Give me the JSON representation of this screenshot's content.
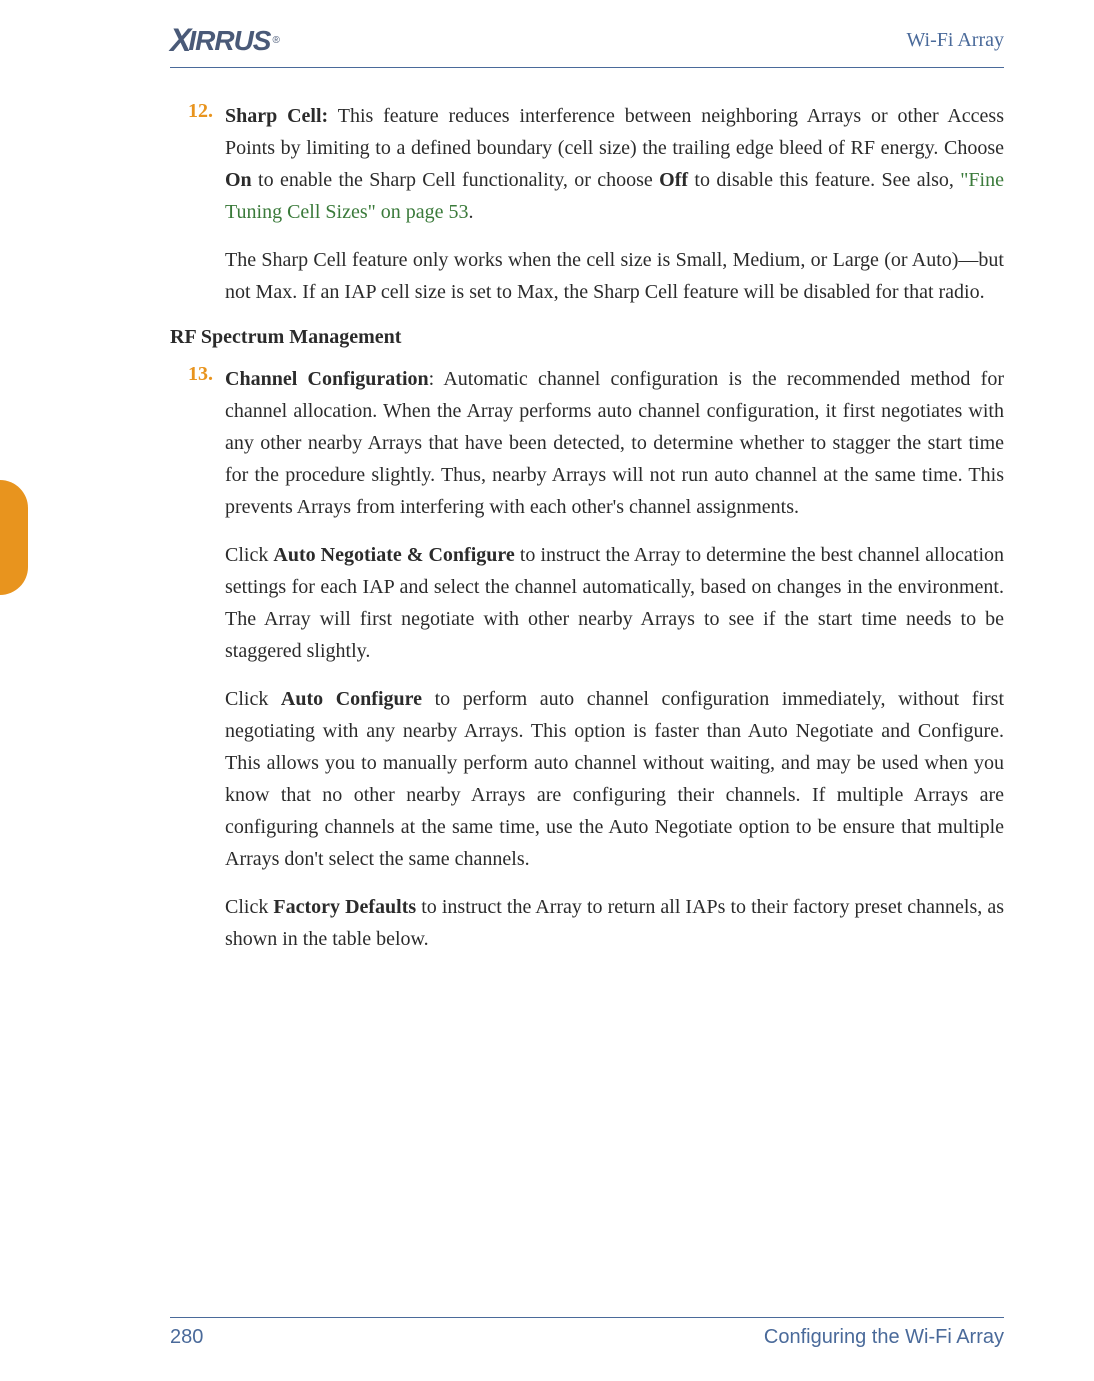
{
  "header": {
    "logo_text": "XIRRUS",
    "right_text": "Wi-Fi Array"
  },
  "items": [
    {
      "number": "12.",
      "title": "Sharp Cell:",
      "para1_a": " This feature reduces interference between neighboring Arrays or other Access Points by limiting to a defined boundary (cell size) the trailing edge bleed of RF energy. Choose ",
      "bold1": "On",
      "para1_b": " to enable the Sharp Cell functionality, or choose ",
      "bold2": "Off",
      "para1_c": " to disable this feature. See also, ",
      "link1": "\"Fine Tuning Cell Sizes\" on page 53",
      "para1_d": ".",
      "para2": "The Sharp Cell feature only works when the cell size is Small, Medium, or Large (or Auto)—but not Max. If an IAP cell size is set to Max, the Sharp Cell feature will be disabled for that radio."
    }
  ],
  "section_heading": "RF Spectrum Management",
  "items2": [
    {
      "number": "13.",
      "title": "Channel Configuration",
      "para1": ": Automatic channel configuration is the recommended method for channel allocation. When the Array performs auto channel configuration, it first negotiates with any other nearby Arrays that have been detected, to determine whether to stagger the start time for the procedure slightly. Thus, nearby Arrays will not run auto channel at the same time. This prevents Arrays from interfering with each other's channel assignments.",
      "para2_a": "Click ",
      "bold1": "Auto Negotiate & Configure",
      "para2_b": " to instruct the Array to determine the best channel allocation settings for each IAP and select the channel automatically, based on changes in the environment. The Array will first negotiate with other nearby Arrays to see if the start time needs to be staggered slightly.",
      "para3_a": "Click ",
      "bold2": "Auto Configure",
      "para3_b": " to perform auto channel configuration immediately, without first negotiating with any nearby Arrays. This option is faster than Auto Negotiate and Configure. This allows you to manually perform auto channel without waiting, and may be used when you know that no other nearby Arrays are configuring their channels. If multiple Arrays are configuring channels at the same time, use the Auto Negotiate option to be ensure that multiple Arrays don't select the same channels.",
      "para4_a": "Click ",
      "bold3": "Factory Defaults",
      "para4_b": " to instruct the Array to return all IAPs to their factory preset channels, as shown in the table below."
    }
  ],
  "footer": {
    "page_number": "280",
    "section_title": "Configuring the Wi-Fi Array"
  }
}
